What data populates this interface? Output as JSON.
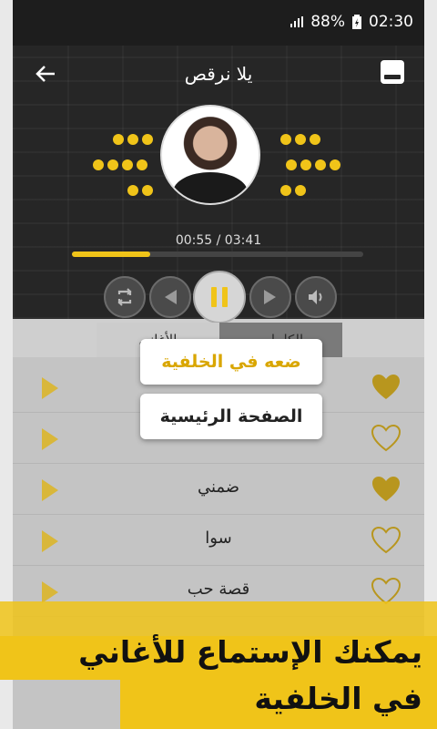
{
  "status_bar": {
    "signal_icon": "signal-icon",
    "battery_percent": "88%",
    "time": "02:30"
  },
  "header": {
    "title": "يلا نرقص",
    "time_display": "00:55 / 03:41",
    "progress_fraction": 0.27
  },
  "tabs": [
    {
      "label": "الأغاني"
    },
    {
      "label": "الكلمات"
    }
  ],
  "songs": [
    {
      "name": "",
      "favorite": true
    },
    {
      "name": "",
      "favorite": false
    },
    {
      "name": "ضمني",
      "favorite": true
    },
    {
      "name": "سوا",
      "favorite": false
    },
    {
      "name": "قصة حب",
      "favorite": false
    }
  ],
  "popup_menu": {
    "background_label": "ضعه في الخلفية",
    "home_label": "الصفحة الرئيسية"
  },
  "banner": {
    "line1": "يمكنك الإستماع للأغاني",
    "line2": "في الخلفية"
  },
  "colors": {
    "accent": "#f0c419",
    "dark": "#262626"
  }
}
